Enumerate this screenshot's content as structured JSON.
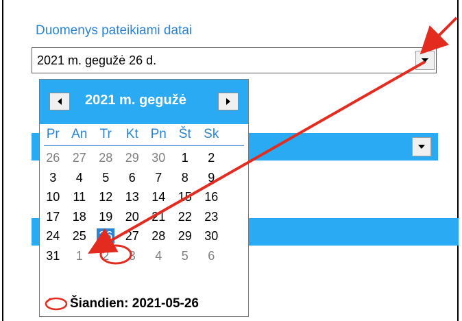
{
  "section": {
    "label": "Duomenys pateikiami datai"
  },
  "date_combo": {
    "value": "2021 m.  gegužė  26 d."
  },
  "calendar": {
    "month_title": "2021 m. gegužė",
    "weekdays": [
      "Pr",
      "An",
      "Tr",
      "Kt",
      "Pn",
      "Št",
      "Sk"
    ],
    "weeks": [
      [
        "26",
        "27",
        "28",
        "29",
        "30",
        "1",
        "2"
      ],
      [
        "3",
        "4",
        "5",
        "6",
        "7",
        "8",
        "9"
      ],
      [
        "10",
        "11",
        "12",
        "13",
        "14",
        "15",
        "16"
      ],
      [
        "17",
        "18",
        "19",
        "20",
        "21",
        "22",
        "23"
      ],
      [
        "24",
        "25",
        "26",
        "27",
        "28",
        "29",
        "30"
      ],
      [
        "31",
        "1",
        "2",
        "3",
        "4",
        "5",
        "6"
      ]
    ],
    "selected_day": "26",
    "today_label": "Šiandien: 2021-05-26"
  },
  "colors": {
    "accent": "#2aaaf2",
    "label": "#2a84d6",
    "arrow": "#e32b1f"
  },
  "icons": [
    "chevron-down-icon",
    "arrow-left-icon",
    "arrow-right-icon",
    "today-circle-icon"
  ]
}
